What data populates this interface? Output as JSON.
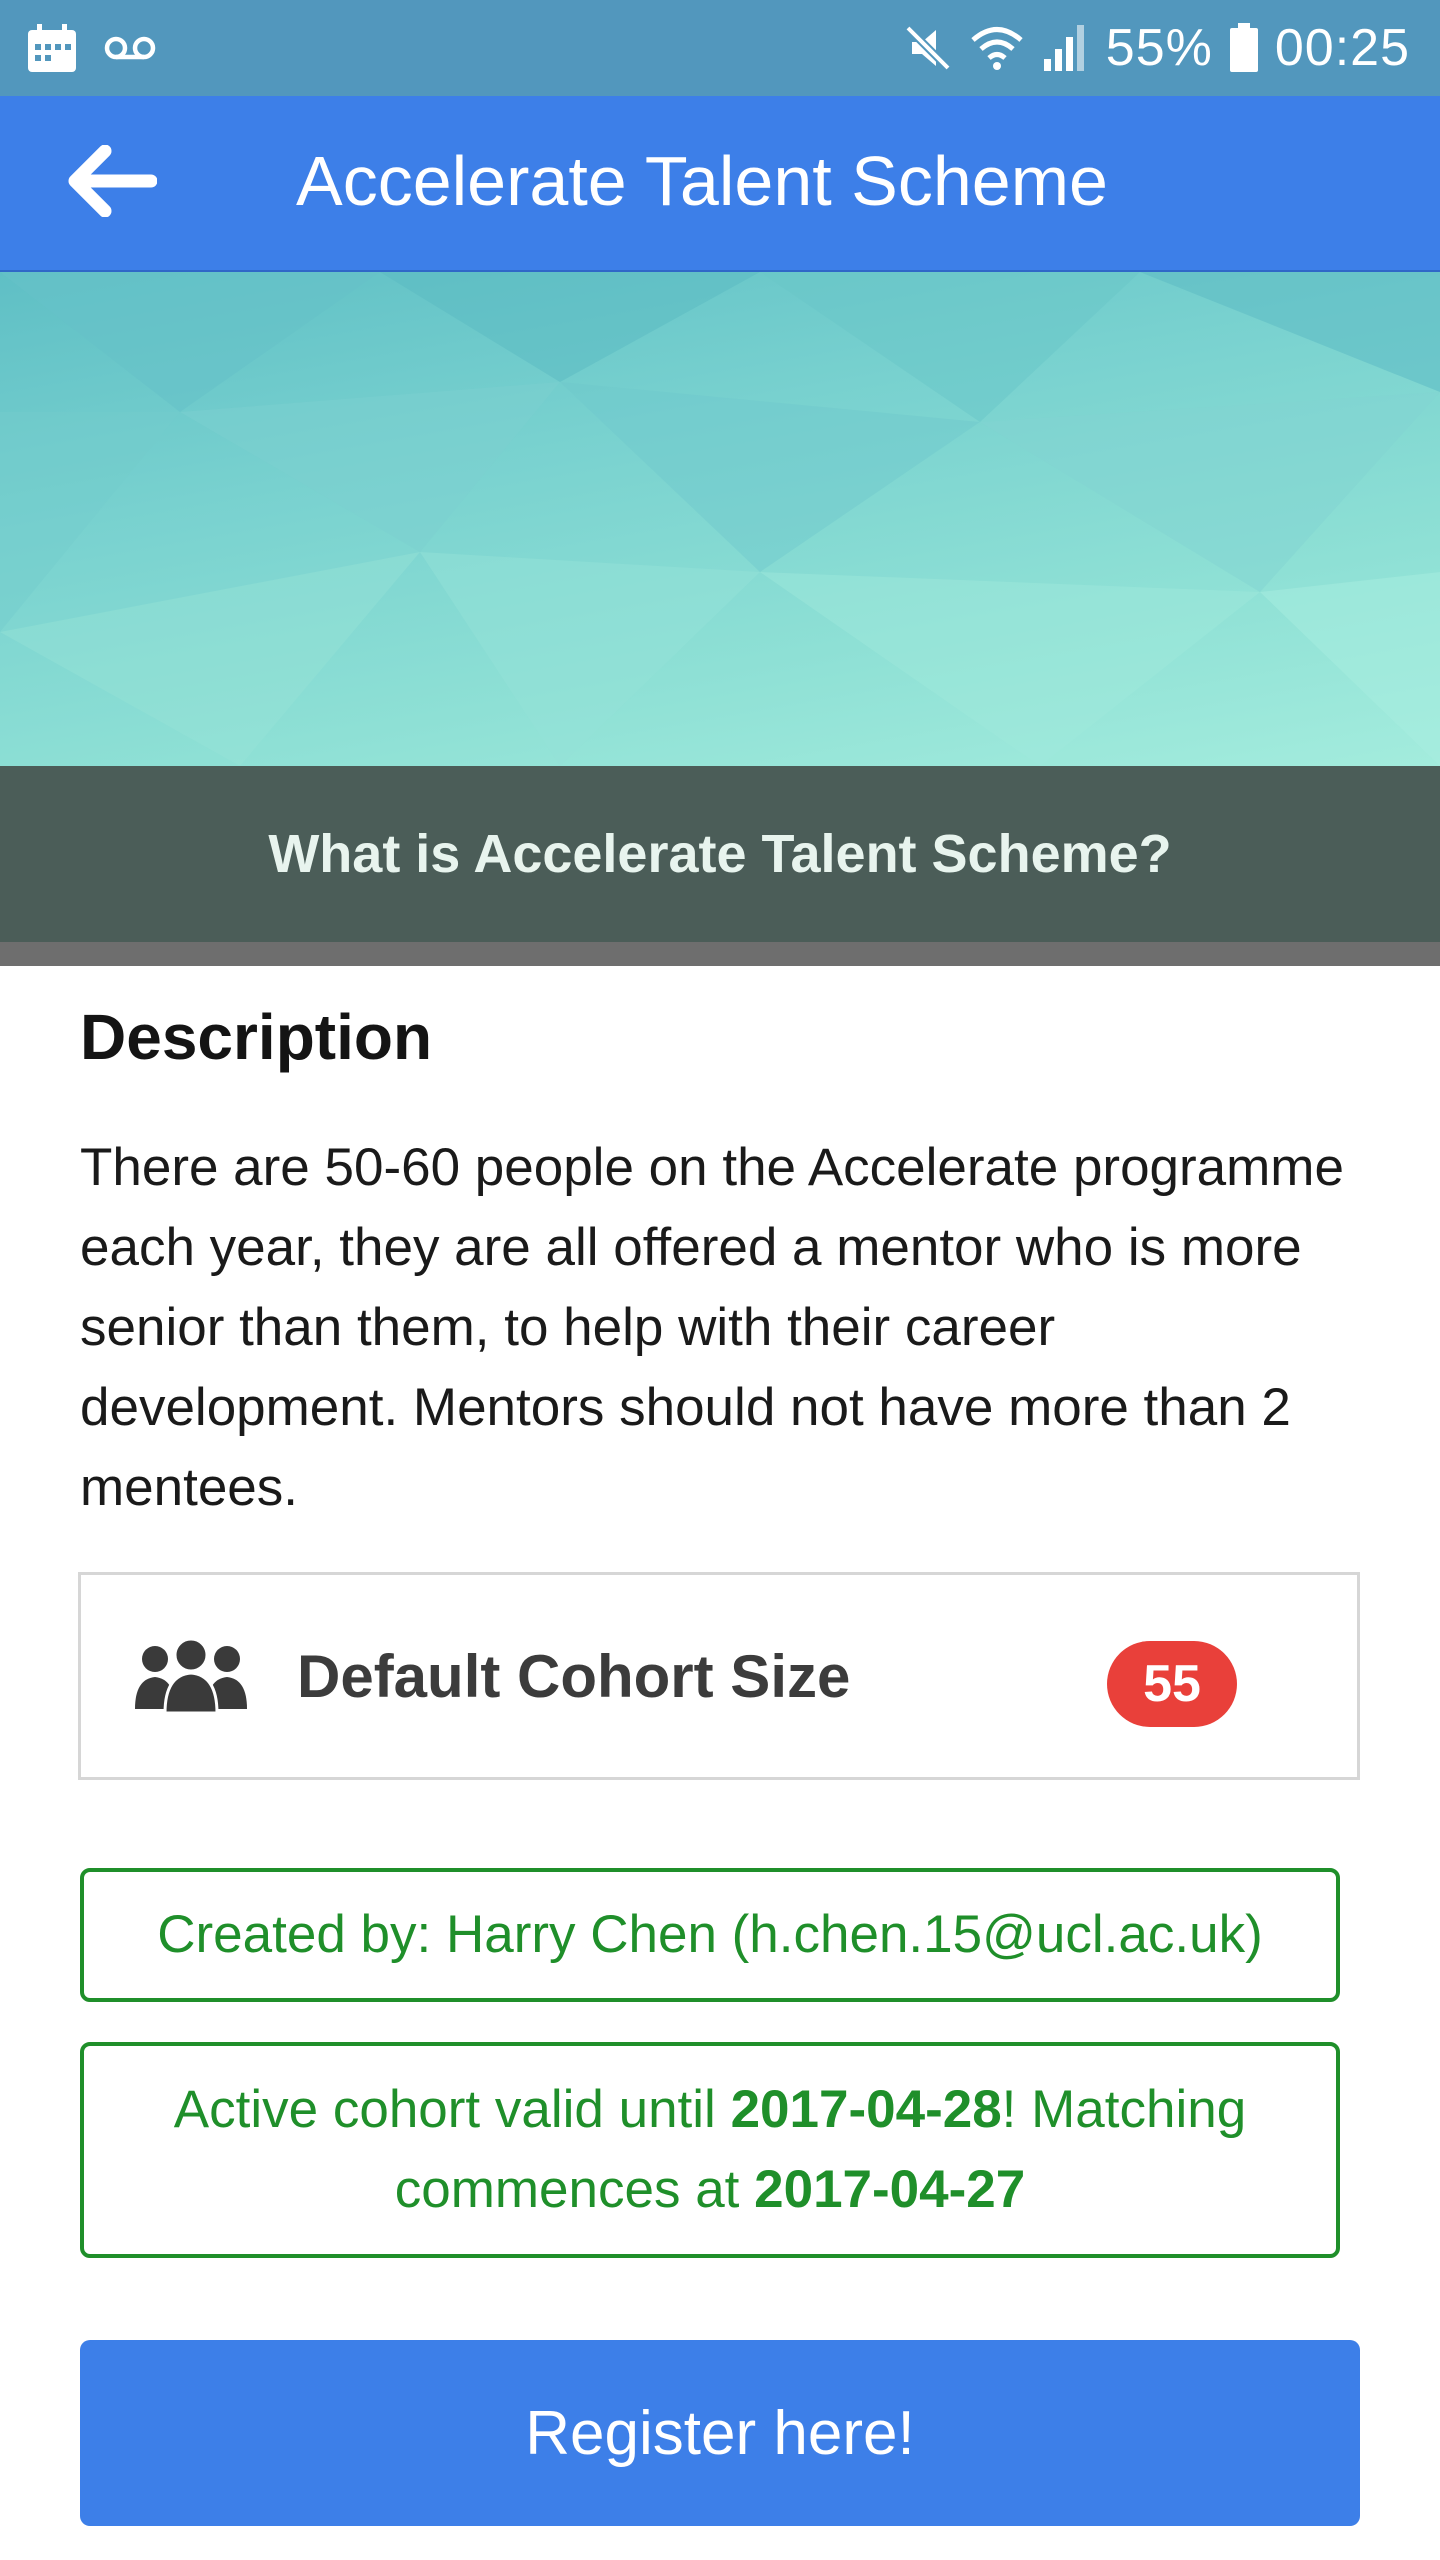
{
  "status_bar": {
    "battery_percent": "55%",
    "time": "00:25",
    "icons": [
      "calendar-icon",
      "voicemail-icon",
      "mute-icon",
      "wifi-icon",
      "signal-icon",
      "battery-icon"
    ]
  },
  "app_bar": {
    "title": "Accelerate Talent Scheme",
    "back_icon": "arrow-back-icon"
  },
  "hero": {
    "caption": "What is Accelerate Talent Scheme?"
  },
  "description": {
    "heading": "Description",
    "text": "There are 50-60 people on the Accelerate programme each year, they are all offered a mentor who is more senior than them, to help with their career development. Mentors should not have more than 2 mentees."
  },
  "cohort": {
    "icon": "group-icon",
    "label": "Default Cohort Size",
    "value": "55"
  },
  "created_by": {
    "text": "Created by: Harry Chen (h.chen.15@ucl.ac.uk)"
  },
  "active_cohort": {
    "prefix": "Active cohort valid until ",
    "valid_until": "2017-04-28",
    "middle": "! Matching commences at ",
    "matching_date": "2017-04-27"
  },
  "register_button": {
    "label": "Register here!"
  },
  "colors": {
    "status_bar": "#5297bd",
    "app_bar": "#3d7fe8",
    "caption_band": "#4b5d58",
    "badge": "#e9403a",
    "success_green": "#1f8f2a",
    "button": "#3d7fe8"
  }
}
